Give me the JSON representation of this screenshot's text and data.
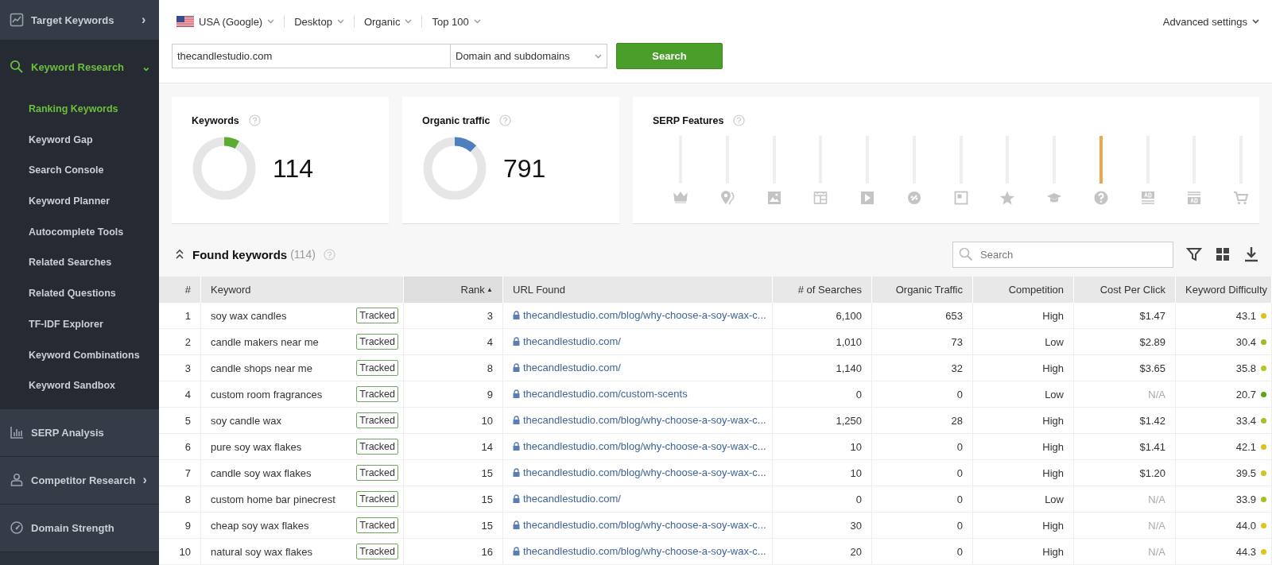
{
  "sidebar": {
    "items": [
      {
        "label": "Target Keywords",
        "chevron": "›",
        "expanded": false,
        "selected": false
      },
      {
        "label": "Keyword Research",
        "chevron": "⌄",
        "expanded": true,
        "selected": true,
        "children": [
          {
            "label": "Ranking Keywords",
            "selected": true
          },
          {
            "label": "Keyword Gap",
            "selected": false
          },
          {
            "label": "Search Console",
            "selected": false
          },
          {
            "label": "Keyword Planner",
            "selected": false
          },
          {
            "label": "Autocomplete Tools",
            "selected": false
          },
          {
            "label": "Related Searches",
            "selected": false
          },
          {
            "label": "Related Questions",
            "selected": false
          },
          {
            "label": "TF-IDF Explorer",
            "selected": false
          },
          {
            "label": "Keyword Combinations",
            "selected": false
          },
          {
            "label": "Keyword Sandbox",
            "selected": false
          }
        ]
      },
      {
        "label": "SERP Analysis",
        "expanded": false,
        "selected": false
      },
      {
        "label": "Competitor Research",
        "chevron": "›",
        "expanded": false,
        "selected": false
      },
      {
        "label": "Domain Strength",
        "expanded": false,
        "selected": false
      }
    ]
  },
  "filters": [
    {
      "label": "USA (Google)",
      "flag": true
    },
    {
      "label": "Desktop",
      "flag": false
    },
    {
      "label": "Organic",
      "flag": false
    },
    {
      "label": "Top 100",
      "flag": false
    }
  ],
  "advanced_settings": "Advanced settings",
  "search_form": {
    "value": "thecandlestudio.com",
    "scope": "Domain and subdomains",
    "button": "Search"
  },
  "cards": [
    {
      "title": "Keywords",
      "value": "114",
      "color": "#5cab32"
    },
    {
      "title": "Organic traffic",
      "value": "791",
      "color": "#4f7fbf"
    }
  ],
  "serp_features": {
    "title": "SERP Features",
    "features": [
      {
        "highlighted": false
      },
      {
        "highlighted": false
      },
      {
        "highlighted": false
      },
      {
        "highlighted": false
      },
      {
        "highlighted": false
      },
      {
        "highlighted": false
      },
      {
        "highlighted": false
      },
      {
        "highlighted": false
      },
      {
        "highlighted": false
      },
      {
        "highlighted": true
      },
      {
        "highlighted": false
      },
      {
        "highlighted": false
      },
      {
        "highlighted": false
      }
    ]
  },
  "found": {
    "title": "Found keywords",
    "count": "(114)",
    "search_placeholder": "Search"
  },
  "table": {
    "columns": [
      {
        "label": "#",
        "sorted": false
      },
      {
        "label": "Keyword",
        "sorted": false
      },
      {
        "label": "Rank",
        "sorted": true
      },
      {
        "label": "URL Found",
        "sorted": false
      },
      {
        "label": "# of Searches",
        "sorted": false
      },
      {
        "label": "Organic Traffic",
        "sorted": false
      },
      {
        "label": "Competition",
        "sorted": false
      },
      {
        "label": "Cost Per Click",
        "sorted": false
      },
      {
        "label": "Keyword Difficulty",
        "sorted": false
      }
    ],
    "sort_arrow": "▲",
    "rows": [
      {
        "n": "1",
        "keyword": "soy wax candles",
        "tag": "Tracked",
        "rank": "3",
        "url": "thecandlestudio.com/blog/why-choose-a-soy-wax-c...",
        "searches": "6,100",
        "traffic": "653",
        "competition": "High",
        "cpc": "$1.47",
        "cpc_na": false,
        "difficulty": "43.1",
        "color": "#d8c41c"
      },
      {
        "n": "2",
        "keyword": "candle makers near me",
        "tag": "Tracked",
        "rank": "4",
        "url": "thecandlestudio.com/",
        "searches": "1,010",
        "traffic": "73",
        "competition": "Low",
        "cpc": "$2.89",
        "cpc_na": false,
        "difficulty": "30.4",
        "color": "#9cbc26"
      },
      {
        "n": "3",
        "keyword": "candle shops near me",
        "tag": "Tracked",
        "rank": "8",
        "url": "thecandlestudio.com/",
        "searches": "1,140",
        "traffic": "32",
        "competition": "High",
        "cpc": "$3.65",
        "cpc_na": false,
        "difficulty": "35.8",
        "color": "#b8c424"
      },
      {
        "n": "4",
        "keyword": "custom room fragrances",
        "tag": "Tracked",
        "rank": "9",
        "url": "thecandlestudio.com/custom-scents",
        "searches": "0",
        "traffic": "0",
        "competition": "Low",
        "cpc": "N/A",
        "cpc_na": true,
        "difficulty": "20.7",
        "color": "#5ea418"
      },
      {
        "n": "5",
        "keyword": "soy candle wax",
        "tag": "Tracked",
        "rank": "10",
        "url": "thecandlestudio.com/blog/why-choose-a-soy-wax-c...",
        "searches": "1,250",
        "traffic": "28",
        "competition": "High",
        "cpc": "$1.42",
        "cpc_na": false,
        "difficulty": "33.4",
        "color": "#a8bf24"
      },
      {
        "n": "6",
        "keyword": "pure soy wax flakes",
        "tag": "Tracked",
        "rank": "14",
        "url": "thecandlestudio.com/blog/why-choose-a-soy-wax-c...",
        "searches": "10",
        "traffic": "0",
        "competition": "High",
        "cpc": "$1.41",
        "cpc_na": false,
        "difficulty": "42.1",
        "color": "#d8c41c"
      },
      {
        "n": "7",
        "keyword": "candle soy wax flakes",
        "tag": "Tracked",
        "rank": "15",
        "url": "thecandlestudio.com/blog/why-choose-a-soy-wax-c...",
        "searches": "10",
        "traffic": "0",
        "competition": "High",
        "cpc": "$1.20",
        "cpc_na": false,
        "difficulty": "39.5",
        "color": "#d0c420"
      },
      {
        "n": "8",
        "keyword": "custom home bar pinecrest",
        "tag": "Tracked",
        "rank": "15",
        "url": "thecandlestudio.com/",
        "searches": "0",
        "traffic": "0",
        "competition": "Low",
        "cpc": "N/A",
        "cpc_na": true,
        "difficulty": "33.9",
        "color": "#a8bf24"
      },
      {
        "n": "9",
        "keyword": "cheap soy wax flakes",
        "tag": "Tracked",
        "rank": "15",
        "url": "thecandlestudio.com/blog/why-choose-a-soy-wax-c...",
        "searches": "30",
        "traffic": "0",
        "competition": "High",
        "cpc": "N/A",
        "cpc_na": true,
        "difficulty": "44.0",
        "color": "#e0c41a"
      },
      {
        "n": "10",
        "keyword": "natural soy wax flakes",
        "tag": "Tracked",
        "rank": "16",
        "url": "thecandlestudio.com/blog/why-choose-a-soy-wax-c...",
        "searches": "20",
        "traffic": "0",
        "competition": "High",
        "cpc": "N/A",
        "cpc_na": true,
        "difficulty": "44.3",
        "color": "#e0c41a"
      }
    ]
  }
}
